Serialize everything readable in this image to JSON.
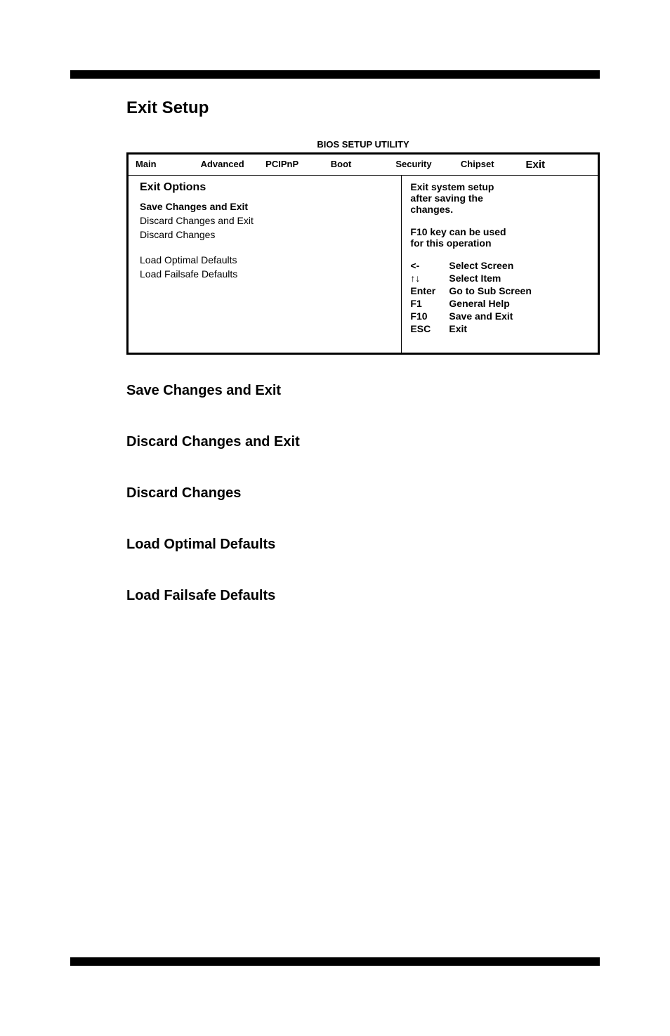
{
  "page": {
    "heading": "Exit Setup",
    "bios_label": "BIOS SETUP UTILITY"
  },
  "tabs": {
    "main": "Main",
    "advanced": "Advanced",
    "pcipnp": "PCIPnP",
    "boot": "Boot",
    "security": "Security",
    "chipset": "Chipset",
    "exit": "Exit"
  },
  "left": {
    "section_title": "Exit Options",
    "items": {
      "save_exit": "Save Changes and Exit",
      "discard_exit": "Discard Changes and Exit",
      "discard": "Discard Changes",
      "load_optimal": "Load Optimal Defaults",
      "load_failsafe": "Load Failsafe Defaults"
    }
  },
  "right": {
    "help_line1": "Exit system setup",
    "help_line2": "after saving the",
    "help_line3": "changes.",
    "f10_line1": "F10 key can be used",
    "f10_line2": "for this operation",
    "keys": {
      "arrow_back": {
        "key": "<-",
        "label": "Select Screen"
      },
      "arrows": {
        "key": "↑↓",
        "label": "Select Item"
      },
      "enter": {
        "key": "Enter",
        "label": "Go to Sub Screen"
      },
      "f1": {
        "key": "F1",
        "label": "General Help"
      },
      "f10": {
        "key": "F10",
        "label": "Save and Exit"
      },
      "esc": {
        "key": "ESC",
        "label": "Exit"
      }
    }
  },
  "sections": {
    "s1": "Save Changes and Exit",
    "s2": "Discard Changes and Exit",
    "s3": "Discard Changes",
    "s4": "Load Optimal Defaults",
    "s5": "Load Failsafe Defaults"
  }
}
